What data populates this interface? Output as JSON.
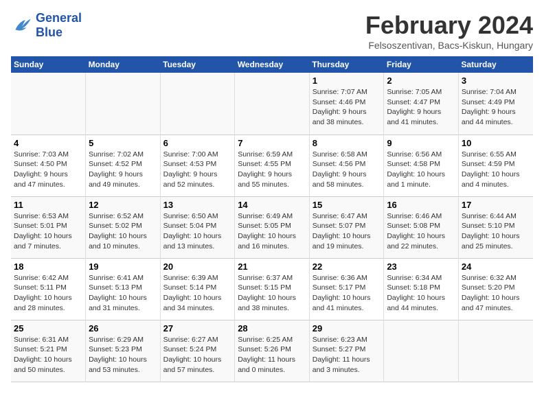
{
  "logo": {
    "line1": "General",
    "line2": "Blue"
  },
  "title": "February 2024",
  "location": "Felsoszentivan, Bacs-Kiskun, Hungary",
  "days_of_week": [
    "Sunday",
    "Monday",
    "Tuesday",
    "Wednesday",
    "Thursday",
    "Friday",
    "Saturday"
  ],
  "weeks": [
    [
      {
        "day": "",
        "info": ""
      },
      {
        "day": "",
        "info": ""
      },
      {
        "day": "",
        "info": ""
      },
      {
        "day": "",
        "info": ""
      },
      {
        "day": "1",
        "info": "Sunrise: 7:07 AM\nSunset: 4:46 PM\nDaylight: 9 hours\nand 38 minutes."
      },
      {
        "day": "2",
        "info": "Sunrise: 7:05 AM\nSunset: 4:47 PM\nDaylight: 9 hours\nand 41 minutes."
      },
      {
        "day": "3",
        "info": "Sunrise: 7:04 AM\nSunset: 4:49 PM\nDaylight: 9 hours\nand 44 minutes."
      }
    ],
    [
      {
        "day": "4",
        "info": "Sunrise: 7:03 AM\nSunset: 4:50 PM\nDaylight: 9 hours\nand 47 minutes."
      },
      {
        "day": "5",
        "info": "Sunrise: 7:02 AM\nSunset: 4:52 PM\nDaylight: 9 hours\nand 49 minutes."
      },
      {
        "day": "6",
        "info": "Sunrise: 7:00 AM\nSunset: 4:53 PM\nDaylight: 9 hours\nand 52 minutes."
      },
      {
        "day": "7",
        "info": "Sunrise: 6:59 AM\nSunset: 4:55 PM\nDaylight: 9 hours\nand 55 minutes."
      },
      {
        "day": "8",
        "info": "Sunrise: 6:58 AM\nSunset: 4:56 PM\nDaylight: 9 hours\nand 58 minutes."
      },
      {
        "day": "9",
        "info": "Sunrise: 6:56 AM\nSunset: 4:58 PM\nDaylight: 10 hours\nand 1 minute."
      },
      {
        "day": "10",
        "info": "Sunrise: 6:55 AM\nSunset: 4:59 PM\nDaylight: 10 hours\nand 4 minutes."
      }
    ],
    [
      {
        "day": "11",
        "info": "Sunrise: 6:53 AM\nSunset: 5:01 PM\nDaylight: 10 hours\nand 7 minutes."
      },
      {
        "day": "12",
        "info": "Sunrise: 6:52 AM\nSunset: 5:02 PM\nDaylight: 10 hours\nand 10 minutes."
      },
      {
        "day": "13",
        "info": "Sunrise: 6:50 AM\nSunset: 5:04 PM\nDaylight: 10 hours\nand 13 minutes."
      },
      {
        "day": "14",
        "info": "Sunrise: 6:49 AM\nSunset: 5:05 PM\nDaylight: 10 hours\nand 16 minutes."
      },
      {
        "day": "15",
        "info": "Sunrise: 6:47 AM\nSunset: 5:07 PM\nDaylight: 10 hours\nand 19 minutes."
      },
      {
        "day": "16",
        "info": "Sunrise: 6:46 AM\nSunset: 5:08 PM\nDaylight: 10 hours\nand 22 minutes."
      },
      {
        "day": "17",
        "info": "Sunrise: 6:44 AM\nSunset: 5:10 PM\nDaylight: 10 hours\nand 25 minutes."
      }
    ],
    [
      {
        "day": "18",
        "info": "Sunrise: 6:42 AM\nSunset: 5:11 PM\nDaylight: 10 hours\nand 28 minutes."
      },
      {
        "day": "19",
        "info": "Sunrise: 6:41 AM\nSunset: 5:13 PM\nDaylight: 10 hours\nand 31 minutes."
      },
      {
        "day": "20",
        "info": "Sunrise: 6:39 AM\nSunset: 5:14 PM\nDaylight: 10 hours\nand 34 minutes."
      },
      {
        "day": "21",
        "info": "Sunrise: 6:37 AM\nSunset: 5:15 PM\nDaylight: 10 hours\nand 38 minutes."
      },
      {
        "day": "22",
        "info": "Sunrise: 6:36 AM\nSunset: 5:17 PM\nDaylight: 10 hours\nand 41 minutes."
      },
      {
        "day": "23",
        "info": "Sunrise: 6:34 AM\nSunset: 5:18 PM\nDaylight: 10 hours\nand 44 minutes."
      },
      {
        "day": "24",
        "info": "Sunrise: 6:32 AM\nSunset: 5:20 PM\nDaylight: 10 hours\nand 47 minutes."
      }
    ],
    [
      {
        "day": "25",
        "info": "Sunrise: 6:31 AM\nSunset: 5:21 PM\nDaylight: 10 hours\nand 50 minutes."
      },
      {
        "day": "26",
        "info": "Sunrise: 6:29 AM\nSunset: 5:23 PM\nDaylight: 10 hours\nand 53 minutes."
      },
      {
        "day": "27",
        "info": "Sunrise: 6:27 AM\nSunset: 5:24 PM\nDaylight: 10 hours\nand 57 minutes."
      },
      {
        "day": "28",
        "info": "Sunrise: 6:25 AM\nSunset: 5:26 PM\nDaylight: 11 hours\nand 0 minutes."
      },
      {
        "day": "29",
        "info": "Sunrise: 6:23 AM\nSunset: 5:27 PM\nDaylight: 11 hours\nand 3 minutes."
      },
      {
        "day": "",
        "info": ""
      },
      {
        "day": "",
        "info": ""
      }
    ]
  ]
}
